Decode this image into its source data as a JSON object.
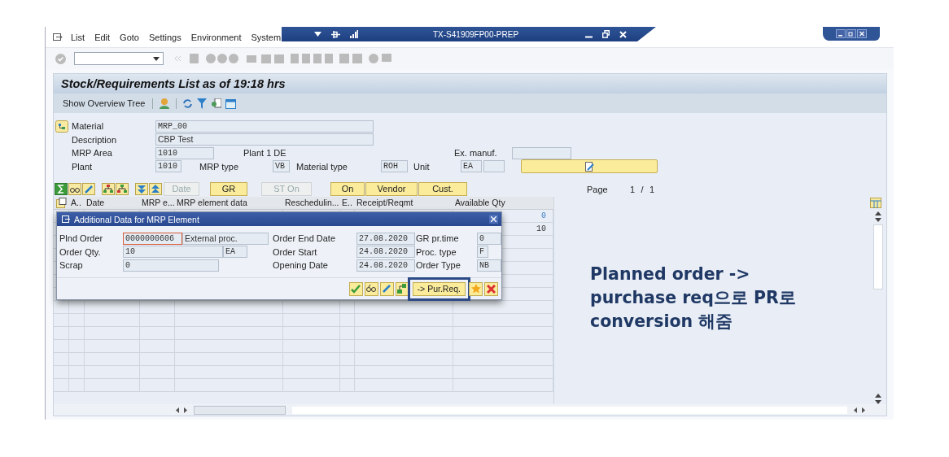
{
  "window": {
    "title": "TX-S41909FP00-PREP"
  },
  "menu": [
    "List",
    "Edit",
    "Goto",
    "Settings",
    "Environment",
    "System"
  ],
  "screen_title": "Stock/Requirements List as of 19:18 hrs",
  "app_toolbar": {
    "label": "Show Overview Tree"
  },
  "header": {
    "material": {
      "label": "Material",
      "value": "MRP_00"
    },
    "description": {
      "label": "Description",
      "value": "CBP Test"
    },
    "mrp_area": {
      "label": "MRP Area",
      "value": "1010",
      "text": "Plant 1 DE"
    },
    "ex_manuf": {
      "label": "Ex. manuf."
    },
    "plant": {
      "label": "Plant",
      "value": "1010"
    },
    "mrp_type": {
      "label": "MRP type",
      "value": "VB"
    },
    "material_type": {
      "label": "Material type",
      "value": "ROH"
    },
    "unit": {
      "label": "Unit",
      "value": "EA"
    }
  },
  "list_buttons": [
    {
      "label": "Date",
      "disabled": true
    },
    {
      "label": "GR",
      "disabled": false
    },
    {
      "label": "ST On",
      "disabled": true
    },
    {
      "label": "On",
      "disabled": false
    },
    {
      "label": "Vendor",
      "disabled": false
    },
    {
      "label": "Cust.",
      "disabled": false
    }
  ],
  "page": {
    "label": "Page",
    "current": "1",
    "separator": "/",
    "total": "1"
  },
  "table": {
    "columns": [
      "A..",
      "Date",
      "MRP e...",
      "MRP element data",
      "Reschedulin...",
      "E..",
      "Receipt/Reqmt",
      "Available Qty"
    ],
    "rows": [
      {
        "available_qty": "0",
        "emphasis": true
      },
      {
        "available_qty": "10",
        "emphasis": false
      }
    ]
  },
  "dialog": {
    "title": "Additional Data for MRP Element",
    "left_fields": [
      {
        "label": "Plnd Order",
        "value": "0000000606",
        "extra": "External proc.",
        "focused": true
      },
      {
        "label": "Order Qty.",
        "value": "10",
        "extra": "EA",
        "focused": false
      },
      {
        "label": "Scrap",
        "value": "0",
        "focused": false
      }
    ],
    "date_fields": [
      {
        "label": "Order End Date",
        "value": "27.08.2020"
      },
      {
        "label": "Order Start",
        "value": "24.08.2020"
      },
      {
        "label": "Opening Date",
        "value": "24.08.2020"
      }
    ],
    "right_fields": [
      {
        "label": "GR pr.time",
        "value": "0"
      },
      {
        "label": "Proc. type",
        "value": "F"
      },
      {
        "label": "Order Type",
        "value": "NB"
      }
    ],
    "convert_button": {
      "label": "-> Pur.Req.",
      "outlined": true
    }
  },
  "annotation": [
    "Planned order ->",
    "purchase req으로 PR로",
    "conversion 해줌"
  ]
}
